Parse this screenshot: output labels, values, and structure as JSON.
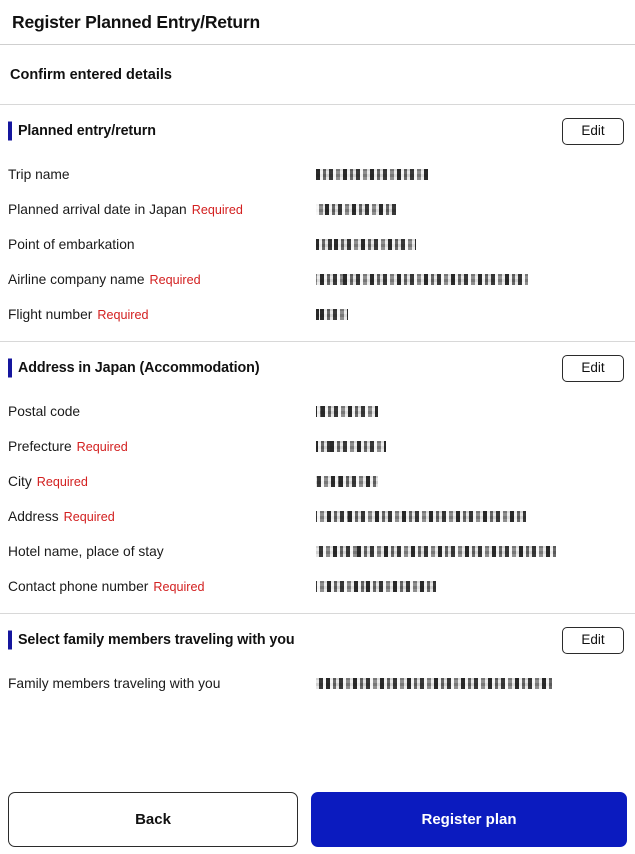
{
  "page": {
    "title": "Register Planned Entry/Return",
    "subheading": "Confirm entered details"
  },
  "colors": {
    "accent_bar": "#15169e",
    "primary_button": "#0b1bbf",
    "required_text": "#d32020",
    "divider": "#d8d8d8"
  },
  "sections": [
    {
      "title": "Planned entry/return",
      "edit_label": "Edit",
      "fields": [
        {
          "label": "Trip name",
          "required": false,
          "value": "",
          "value_redacted": true,
          "value_width": 112
        },
        {
          "label": "Planned arrival date in Japan",
          "required": true,
          "value": "",
          "value_redacted": true,
          "value_width": 80
        },
        {
          "label": "Point of embarkation",
          "required": false,
          "value": "",
          "value_redacted": true,
          "value_width": 100
        },
        {
          "label": "Airline company name",
          "required": true,
          "value": "",
          "value_redacted": true,
          "value_width": 212
        },
        {
          "label": "Flight number",
          "required": true,
          "value": "",
          "value_redacted": true,
          "value_width": 32
        }
      ]
    },
    {
      "title": "Address in Japan (Accommodation)",
      "edit_label": "Edit",
      "fields": [
        {
          "label": "Postal code",
          "required": false,
          "value": "",
          "value_redacted": true,
          "value_width": 62
        },
        {
          "label": "Prefecture",
          "required": true,
          "value": "",
          "value_redacted": true,
          "value_width": 70
        },
        {
          "label": "City",
          "required": true,
          "value": "",
          "value_redacted": true,
          "value_width": 62
        },
        {
          "label": "Address",
          "required": true,
          "value": "",
          "value_redacted": true,
          "value_width": 210
        },
        {
          "label": "Hotel name, place of stay",
          "required": false,
          "value": "",
          "value_redacted": true,
          "value_width": 240
        },
        {
          "label": "Contact phone number",
          "required": true,
          "value": "",
          "value_redacted": true,
          "value_width": 120
        }
      ]
    },
    {
      "title": "Select family members traveling with you",
      "edit_label": "Edit",
      "fields": [
        {
          "label": "Family members traveling with you",
          "required": false,
          "value": "",
          "value_redacted": true,
          "value_width": 236
        }
      ]
    }
  ],
  "required_label": "Required",
  "footer": {
    "back_label": "Back",
    "register_label": "Register plan"
  }
}
